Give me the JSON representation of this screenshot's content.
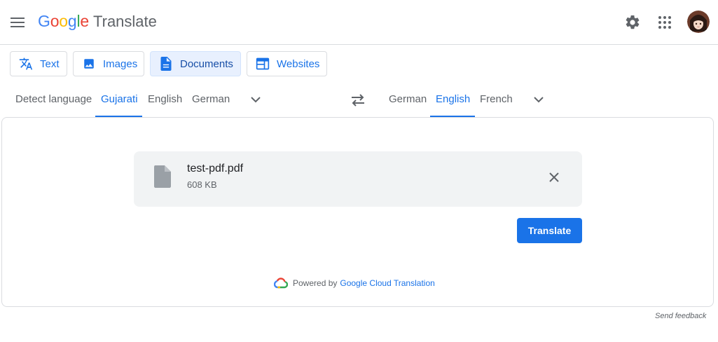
{
  "header": {
    "logo_word": "Google",
    "logo_product": "Translate",
    "icons": [
      "menu-icon",
      "gear-icon",
      "apps-grid-icon",
      "avatar"
    ]
  },
  "modes": [
    {
      "label": "Text",
      "icon": "translate-text-icon",
      "active": false
    },
    {
      "label": "Images",
      "icon": "image-icon",
      "active": false
    },
    {
      "label": "Documents",
      "icon": "document-icon",
      "active": true
    },
    {
      "label": "Websites",
      "icon": "website-icon",
      "active": false
    }
  ],
  "source_languages": {
    "items": [
      "Detect language",
      "Gujarati",
      "English",
      "German"
    ],
    "selected": "Gujarati"
  },
  "target_languages": {
    "items": [
      "German",
      "English",
      "French"
    ],
    "selected": "English"
  },
  "file": {
    "name": "test-pdf.pdf",
    "size": "608 KB"
  },
  "translate_button": "Translate",
  "powered_by": {
    "prefix": "Powered by",
    "link": "Google Cloud Translation"
  },
  "feedback": "Send feedback",
  "colors": {
    "accent": "#1a73e8",
    "active_tab_bg": "#e8f0fe",
    "file_box_bg": "#f1f3f4"
  }
}
